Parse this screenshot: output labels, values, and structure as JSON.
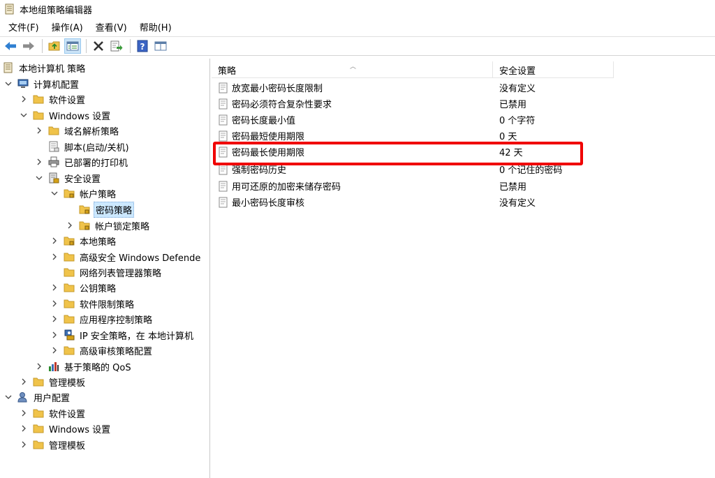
{
  "window": {
    "title": "本地组策略编辑器"
  },
  "menu": [
    {
      "label": "文件(F)"
    },
    {
      "label": "操作(A)"
    },
    {
      "label": "查看(V)"
    },
    {
      "label": "帮助(H)"
    }
  ],
  "toolbar": {
    "buttons": [
      "back-icon",
      "forward-icon",
      "up-folder-icon",
      "show-hide-tree-icon",
      "delete-icon",
      "export-list-icon",
      "help-icon",
      "properties-view-icon"
    ]
  },
  "tree": [
    {
      "label": "本地计算机 策略"
    },
    {
      "label": "计算机配置"
    },
    {
      "label": "软件设置"
    },
    {
      "label": "Windows 设置"
    },
    {
      "label": "域名解析策略"
    },
    {
      "label": "脚本(启动/关机)"
    },
    {
      "label": "已部署的打印机"
    },
    {
      "label": "安全设置"
    },
    {
      "label": "帐户策略"
    },
    {
      "label": "密码策略"
    },
    {
      "label": "帐户锁定策略"
    },
    {
      "label": "本地策略"
    },
    {
      "label": "高级安全 Windows Defende"
    },
    {
      "label": "网络列表管理器策略"
    },
    {
      "label": "公钥策略"
    },
    {
      "label": "软件限制策略"
    },
    {
      "label": "应用程序控制策略"
    },
    {
      "label": "IP 安全策略，在 本地计算机"
    },
    {
      "label": "高级审核策略配置"
    },
    {
      "label": "基于策略的 QoS"
    },
    {
      "label": "管理模板"
    },
    {
      "label": "用户配置"
    },
    {
      "label": "软件设置"
    },
    {
      "label": "Windows 设置"
    },
    {
      "label": "管理模板"
    }
  ],
  "list": {
    "columns": {
      "policy": "策略",
      "setting": "安全设置"
    },
    "rows": [
      {
        "policy": "放宽最小密码长度限制",
        "setting": "没有定义"
      },
      {
        "policy": "密码必须符合复杂性要求",
        "setting": "已禁用"
      },
      {
        "policy": "密码长度最小值",
        "setting": "0 个字符"
      },
      {
        "policy": "密码最短使用期限",
        "setting": "0 天"
      },
      {
        "policy": "密码最长使用期限",
        "setting": "42 天"
      },
      {
        "policy": "强制密码历史",
        "setting": "0 个记住的密码"
      },
      {
        "policy": "用可还原的加密来储存密码",
        "setting": "已禁用"
      },
      {
        "policy": "最小密码长度审核",
        "setting": "没有定义"
      }
    ]
  },
  "colors": {
    "highlight": "#f00000",
    "selection": "#cce8ff",
    "folder": "#f0c34a"
  }
}
